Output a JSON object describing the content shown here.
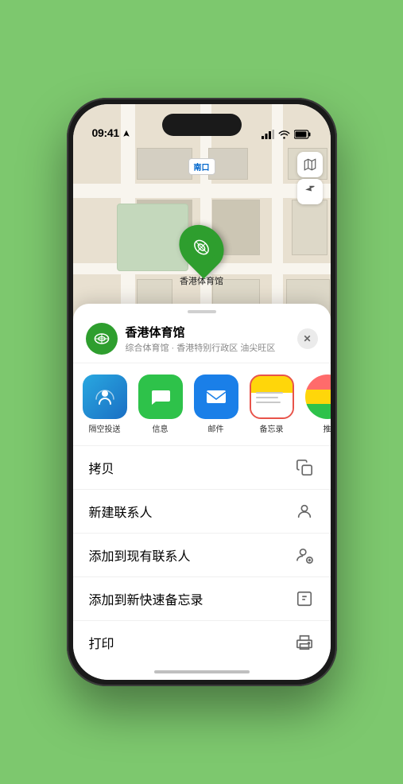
{
  "status": {
    "time": "09:41",
    "location_arrow": true
  },
  "map": {
    "label_flag": "南口",
    "pin_name": "香港体育馆",
    "controls": {
      "map_icon": "🗺",
      "location_icon": "⬆"
    }
  },
  "venue_card": {
    "name": "香港体育馆",
    "subtitle": "综合体育馆 · 香港特别行政区 油尖旺区",
    "close_label": "✕"
  },
  "share_items": [
    {
      "id": "airdrop",
      "label": "隔空投送"
    },
    {
      "id": "messages",
      "label": "信息"
    },
    {
      "id": "mail",
      "label": "邮件"
    },
    {
      "id": "notes",
      "label": "备忘录"
    },
    {
      "id": "more",
      "label": "推"
    }
  ],
  "actions": [
    {
      "label": "拷贝",
      "icon": "copy"
    },
    {
      "label": "新建联系人",
      "icon": "person"
    },
    {
      "label": "添加到现有联系人",
      "icon": "person-add"
    },
    {
      "label": "添加到新快速备忘录",
      "icon": "note"
    },
    {
      "label": "打印",
      "icon": "print"
    }
  ]
}
